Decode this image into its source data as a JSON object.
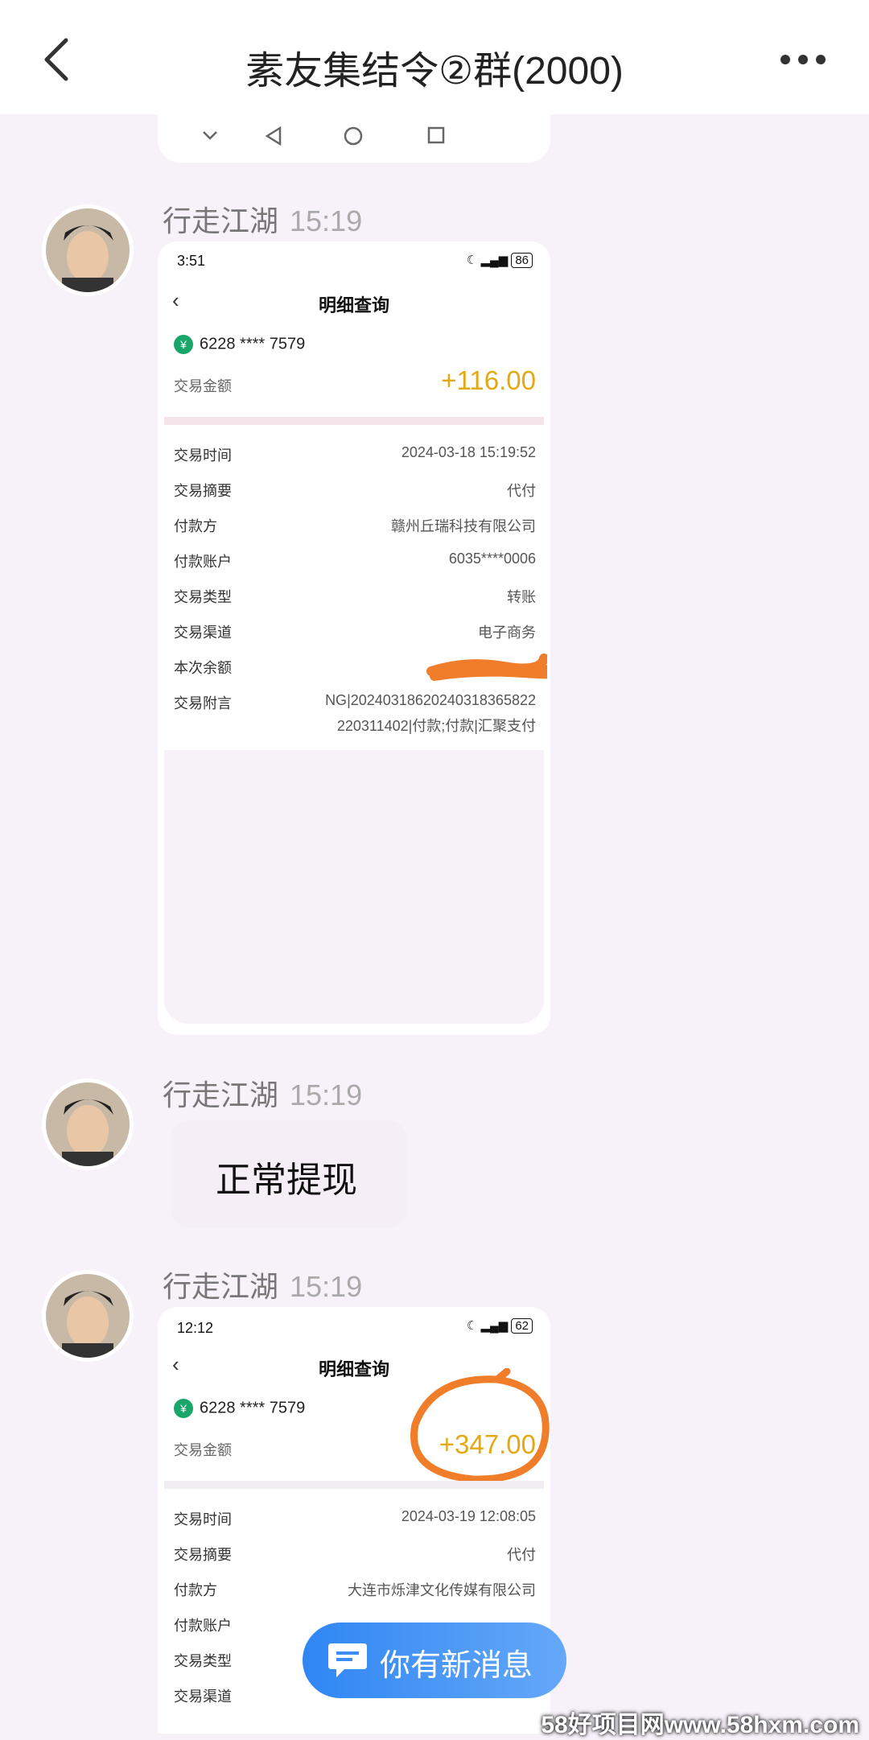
{
  "header": {
    "title": "素友集结令②群(2000)",
    "back_icon": "back-arrow-icon",
    "more_icon": "more-dots-icon"
  },
  "messages": [
    {
      "sender": "行走江湖",
      "time": "15:19"
    },
    {
      "sender": "行走江湖",
      "time": "15:19",
      "text": "正常提现"
    },
    {
      "sender": "行走江湖",
      "time": "15:19"
    }
  ],
  "shot1": {
    "status_time": "3:51",
    "status_right": "86",
    "title": "明细查询",
    "card": "6228 **** 7579",
    "amount_label": "交易金额",
    "amount": "+116.00",
    "rows": [
      {
        "k": "交易时间",
        "v": "2024-03-18 15:19:52"
      },
      {
        "k": "交易摘要",
        "v": "代付"
      },
      {
        "k": "付款方",
        "v": "赣州丘瑞科技有限公司"
      },
      {
        "k": "付款账户",
        "v": "6035****0006"
      },
      {
        "k": "交易类型",
        "v": "转账"
      },
      {
        "k": "交易渠道",
        "v": "电子商务"
      },
      {
        "k": "本次余额",
        "v": ""
      },
      {
        "k": "交易附言",
        "v": "NG|20240318620240318365822"
      },
      {
        "k": "",
        "v": "220311402|付款;付款|汇聚支付"
      }
    ]
  },
  "shot2": {
    "status_time": "12:12",
    "status_right": "62",
    "title": "明细查询",
    "card": "6228 **** 7579",
    "amount_label": "交易金额",
    "amount": "+347.00",
    "rows": [
      {
        "k": "交易时间",
        "v": "2024-03-19 12:08:05"
      },
      {
        "k": "交易摘要",
        "v": "代付"
      },
      {
        "k": "付款方",
        "v": "大连市烁津文化传媒有限公司"
      },
      {
        "k": "付款账户",
        "v": ""
      },
      {
        "k": "交易类型",
        "v": ""
      },
      {
        "k": "交易渠道",
        "v": ""
      }
    ]
  },
  "new_message": {
    "label": "你有新消息",
    "icon": "chat-bubble-icon"
  },
  "watermark": "58好项目网www.58hxm.com",
  "colors": {
    "amount": "#e6a812",
    "pill": "#2f86f3",
    "annotation": "#f07d2a"
  }
}
